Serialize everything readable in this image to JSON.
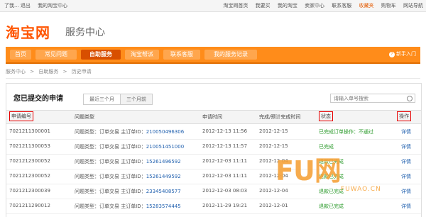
{
  "topbar": {
    "left": [
      "了我... 退出",
      "我的淘宝中心"
    ],
    "right": [
      "淘宝网首页",
      "我要买",
      "我的淘宝",
      "卖家中心",
      "联系客服",
      "收藏夹",
      "购物车",
      "网站导航"
    ],
    "fav_label": "收藏夹"
  },
  "logo": {
    "brand": "淘宝网",
    "subtitle": "服务中心"
  },
  "nav": {
    "tabs": [
      "首页",
      "常见问题",
      "自助服务",
      "淘宝帮派",
      "联系客服",
      "我的服务记录"
    ],
    "active_index": 2,
    "help": "新手入门"
  },
  "breadcrumb": [
    "服务中心",
    ">",
    "自助服务",
    ">",
    "历史申请"
  ],
  "panel": {
    "title": "您已提交的申请",
    "filter_tabs": [
      "最近三个月",
      "三个月前"
    ],
    "search_placeholder": "请输入单号搜索"
  },
  "table": {
    "headers": [
      "申请编号",
      "问题类型",
      "申请时间",
      "完成/预计完成时间",
      "状态",
      "操作"
    ],
    "rows": [
      {
        "id": "7021211300001",
        "type": "问题类型：订单交易",
        "uid_label": "主订单ID：",
        "uid": "210050496306",
        "time": "2012-12-13 11:56",
        "done": "2012-12-15",
        "status": "已完成订单操作：不通过",
        "action": "详情"
      },
      {
        "id": "7021211300053",
        "type": "问题类型：订单交易",
        "uid_label": "主订单ID：",
        "uid": "210051451000",
        "time": "2012-12-13 11:57",
        "done": "2012-12-15",
        "status": "已完成",
        "action": "详情"
      },
      {
        "id": "7021212300052",
        "type": "问题类型：订单交易",
        "uid_label": "主订单ID：",
        "uid": "15261496592",
        "time": "2012-12-03 11:11",
        "done": "2012-12-04",
        "status": "退款已完成",
        "action": "详情"
      },
      {
        "id": "7021212300052",
        "type": "问题类型：订单交易",
        "uid_label": "主订单ID：",
        "uid": "15261449592",
        "time": "2012-12-03 11:11",
        "done": "2012-12-04",
        "status": "退款已完成",
        "action": "详情"
      },
      {
        "id": "7021212300039",
        "type": "问题类型：订单交易",
        "uid_label": "主订单ID：",
        "uid": "23345408577",
        "time": "2012-12-03 08:03",
        "done": "2012-12-04",
        "status": "退款已完成",
        "action": "详情"
      },
      {
        "id": "7021211290012",
        "type": "问题类型：订单交易",
        "uid_label": "主订单ID：",
        "uid": "15283574445",
        "time": "2012-11-29 19:21",
        "done": "2012-12-01",
        "status": "退款已完成",
        "action": "详情"
      }
    ]
  },
  "watermark": {
    "big": "FU网",
    "small": "FUWAO.CN"
  },
  "colors": {
    "accent": "#ff8c1a",
    "brand": "#ff5500",
    "link": "#1f5fae",
    "status_green": "#2a9a2a",
    "highlight_box": "#e60000"
  }
}
